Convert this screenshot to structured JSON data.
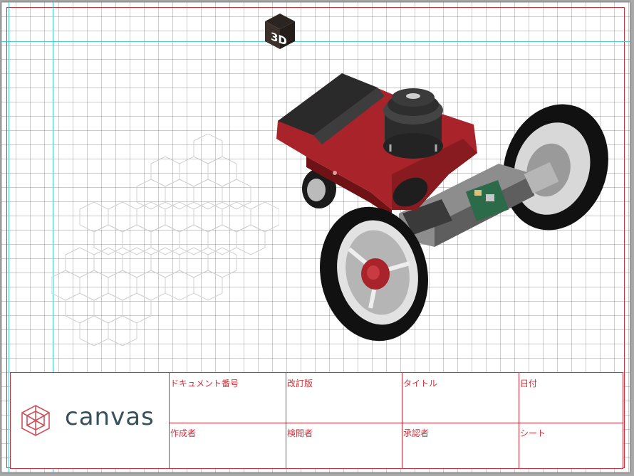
{
  "view": {
    "badge_icon": "3d-cube-icon",
    "badge_text": "3D"
  },
  "title_block": {
    "brand": "canvas",
    "brand_icon": "canvas-logo-icon",
    "fields": {
      "document_number": "ドキュメント番号",
      "revision": "改訂版",
      "title": "タイトル",
      "date": "日付",
      "author": "作成者",
      "reviewer": "検閲者",
      "approver": "承認者",
      "sheet": "シート"
    }
  },
  "colors": {
    "frame": "#d4303a",
    "guide": "#46c8d8",
    "brand_text": "#36505c",
    "robot_body": "#a9242a"
  }
}
